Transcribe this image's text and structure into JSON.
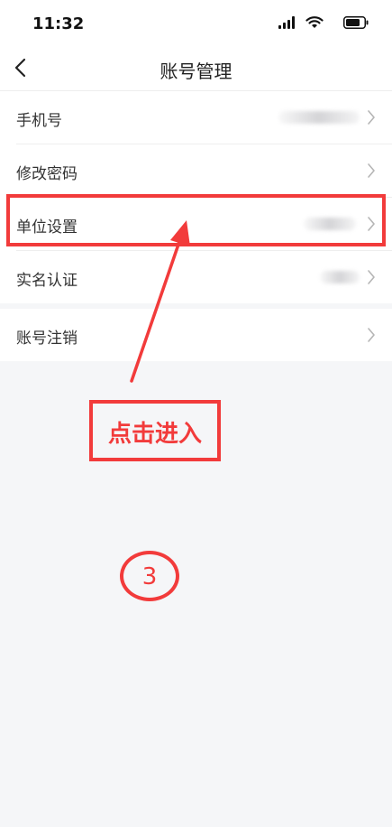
{
  "status_bar": {
    "time": "11:32"
  },
  "nav": {
    "title": "账号管理"
  },
  "section1": {
    "items": [
      {
        "label": "手机号"
      },
      {
        "label": "修改密码"
      },
      {
        "label": "单位设置"
      },
      {
        "label": "实名认证"
      }
    ]
  },
  "section2": {
    "items": [
      {
        "label": "账号注销"
      }
    ]
  },
  "annotations": {
    "callout": "点击进入",
    "step": "3",
    "color": "#f23b3b"
  },
  "icons": [
    "back-arrow-icon",
    "chevron-right-icon",
    "signal-icon",
    "wifi-icon",
    "battery-icon"
  ]
}
